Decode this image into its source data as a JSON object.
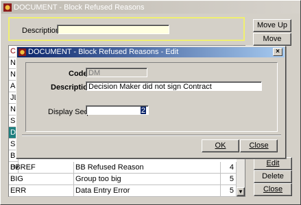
{
  "main": {
    "title": "DOCUMENT - Block Refused Reasons",
    "search": {
      "label": "Description",
      "value": ""
    },
    "move_up": "Move Up",
    "move_down": "Move Down",
    "buttons": {
      "edit": "Edit",
      "delete": "Delete",
      "close": "Close"
    },
    "partial_codes": [
      "Co",
      "NC",
      "NC",
      "AC",
      "JL",
      "NC",
      "SF",
      "DI",
      "SM",
      "BU",
      "DA"
    ],
    "rows": [
      {
        "code": "BBREF",
        "description": "BB Refused Reason",
        "seq": "4"
      },
      {
        "code": "BIG",
        "description": "Group too big",
        "seq": "5"
      },
      {
        "code": "ERR",
        "description": "Data Entry Error",
        "seq": "5"
      }
    ],
    "scroll_down_icon": "arrow-down"
  },
  "dialog": {
    "title": "DOCUMENT - Block Refused Reasons - Edit",
    "code_label": "Code",
    "code_value": "DM",
    "desc_label": "Description",
    "desc_value": "Decision Maker did not sign Contract",
    "seq_label": "Display Seq.",
    "seq_value": "2",
    "ok": "OK",
    "close": "Close"
  }
}
